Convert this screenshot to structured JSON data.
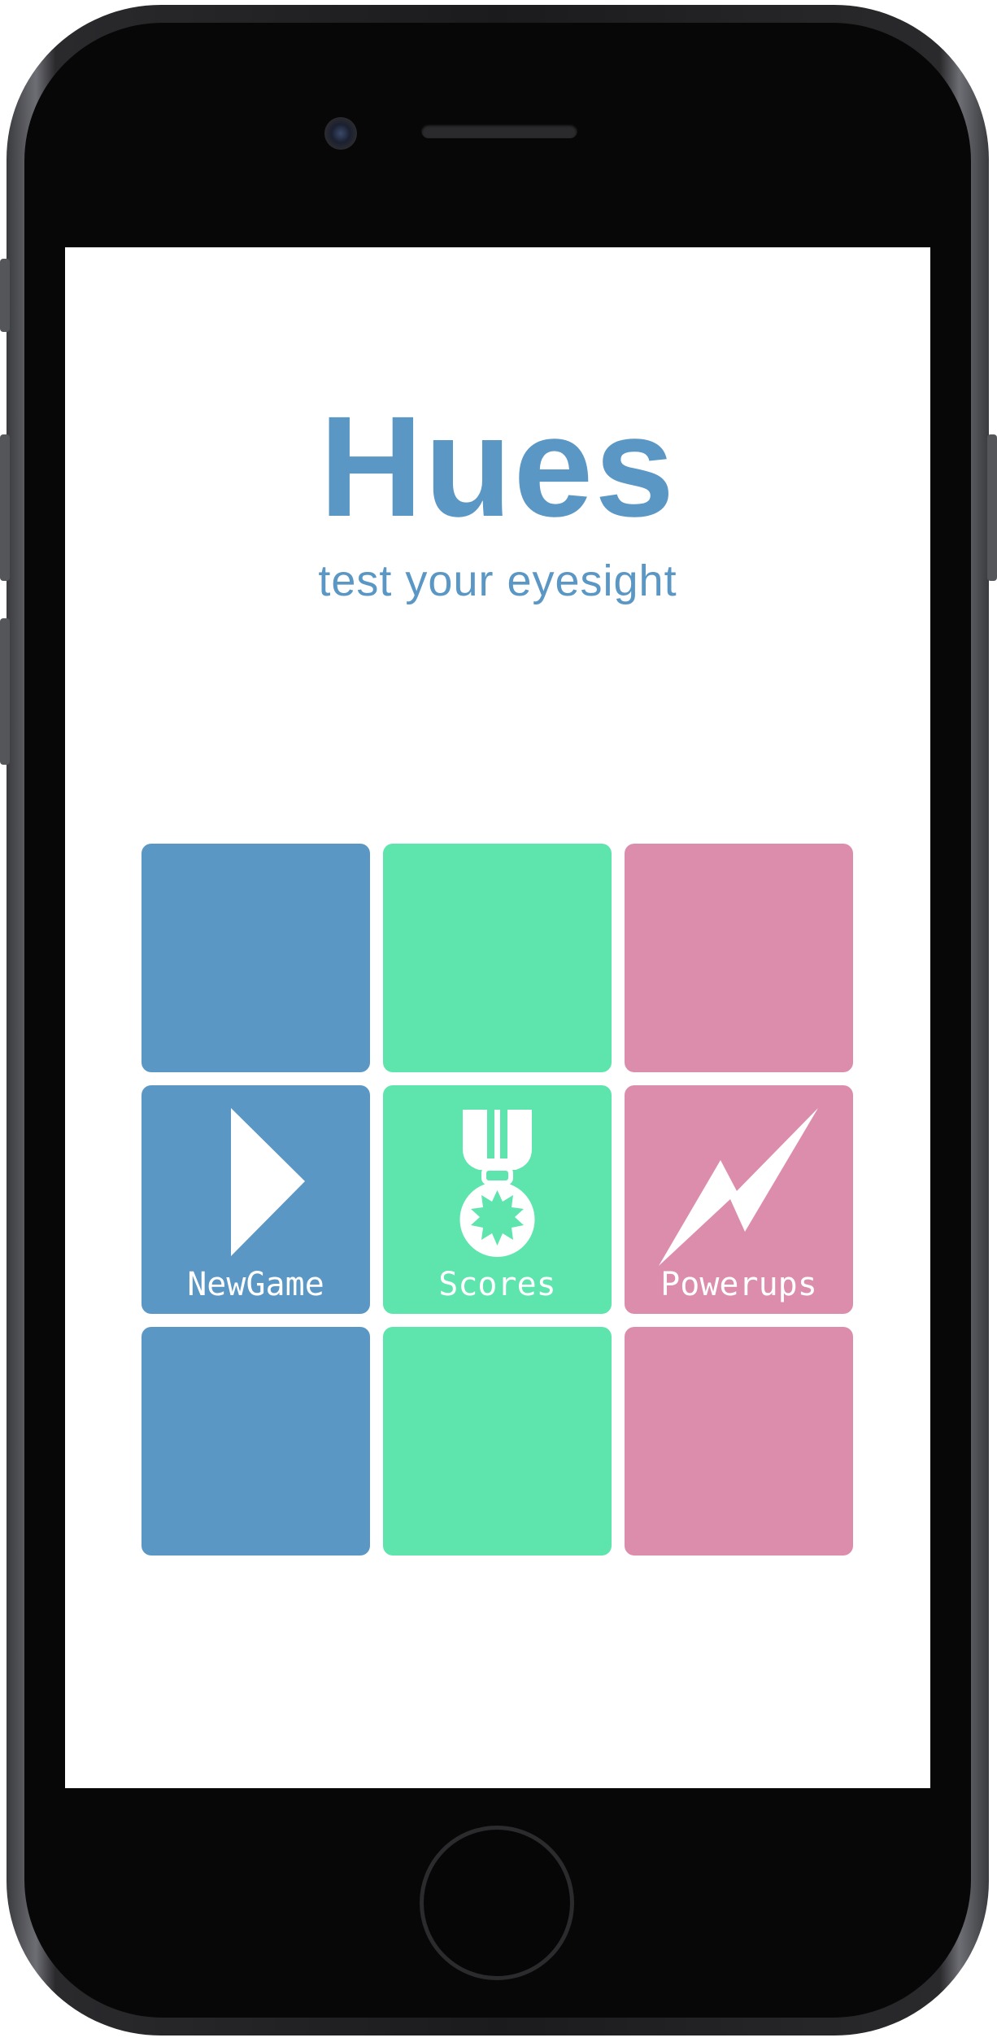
{
  "app": {
    "title": "Hues",
    "subtitle": "test your eyesight"
  },
  "colors": {
    "blue": "#5b97c4",
    "green": "#5ee4ad",
    "pink": "#dd8dac",
    "background": "#ffffff"
  },
  "menu": {
    "new_game": {
      "label": "NewGame",
      "icon": "play-icon"
    },
    "scores": {
      "label": "Scores",
      "icon": "medal-icon"
    },
    "powerups": {
      "label": "Powerups",
      "icon": "lightning-icon"
    }
  }
}
